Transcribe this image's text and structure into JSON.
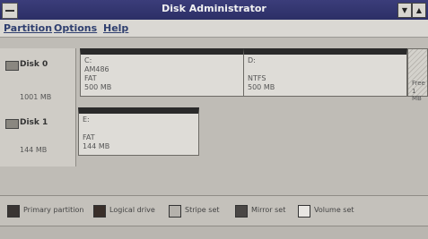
{
  "window": {
    "title": "Disk Administrator"
  },
  "menu": {
    "items": [
      "Partition",
      "Options",
      "Help"
    ]
  },
  "disks": [
    {
      "name": "Disk 0",
      "size": "1001 MB",
      "partitions": [
        {
          "letter": "C:",
          "label": "AM486",
          "fs": "FAT",
          "size": "500 MB"
        },
        {
          "letter": "D:",
          "label": "",
          "fs": "NTFS",
          "size": "500 MB"
        }
      ],
      "free_space": {
        "line1": "Free",
        "line2": "1 MB"
      }
    },
    {
      "name": "Disk 1",
      "size": "144 MB",
      "partitions": [
        {
          "letter": "E:",
          "label": "",
          "fs": "FAT",
          "size": "144 MB"
        }
      ]
    }
  ],
  "legend": [
    {
      "label": "Primary partition",
      "color": "#3a3634"
    },
    {
      "label": "Logical drive",
      "color": "#3a2f2a"
    },
    {
      "label": "Stripe set",
      "color": "#b5b2ac"
    },
    {
      "label": "Mirror set",
      "color": "#4a4745"
    },
    {
      "label": "Volume set",
      "color": "#e8e6e2"
    }
  ]
}
